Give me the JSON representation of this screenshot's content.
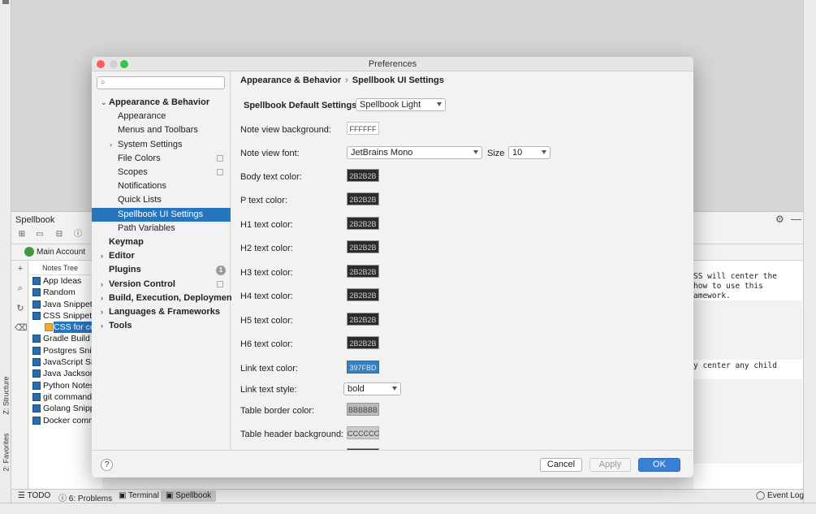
{
  "ide": {
    "tool_window_title": "Spellbook",
    "account_label": "Main Account",
    "notes_tree_header": "Notes Tree",
    "notes": [
      "App Ideas",
      "Random",
      "Java Snippet",
      "CSS Snippets",
      "CSS for ce",
      "Gradle Build",
      "Postgres Snip",
      "JavaScript Sn",
      "Java Jackson",
      "Python Notes",
      "git command",
      "Golang Snipp",
      "Docker comm"
    ],
    "selected_note_index": 4,
    "editor_lines": [
      "SS will center the",
      " how to use this",
      "amework.",
      "y center any child"
    ],
    "vertical_labels": {
      "structure": "Z: Structure",
      "favorites": "2: Favorites"
    },
    "status_bar": {
      "todo": "TODO",
      "problems": "6: Problems",
      "terminal": "Terminal",
      "spellbook": "Spellbook",
      "event_log": "Event Log"
    }
  },
  "dialog": {
    "title": "Preferences",
    "search": {
      "value": "",
      "placeholder": ""
    },
    "nav": [
      {
        "label": "Appearance & Behavior",
        "bold": true,
        "chevron": "v",
        "level": 0
      },
      {
        "label": "Appearance",
        "level": 1
      },
      {
        "label": "Menus and Toolbars",
        "level": 1
      },
      {
        "label": "System Settings",
        "level": 1,
        "chevron": ">"
      },
      {
        "label": "File Colors",
        "level": 1,
        "copy": true
      },
      {
        "label": "Scopes",
        "level": 1,
        "copy": true
      },
      {
        "label": "Notifications",
        "level": 1
      },
      {
        "label": "Quick Lists",
        "level": 1
      },
      {
        "label": "Spellbook UI Settings",
        "level": 1,
        "selected": true
      },
      {
        "label": "Path Variables",
        "level": 1
      },
      {
        "label": "Keymap",
        "bold": true,
        "level": 0
      },
      {
        "label": "Editor",
        "bold": true,
        "level": 0,
        "chevron": ">"
      },
      {
        "label": "Plugins",
        "bold": true,
        "level": 0,
        "badge": "1"
      },
      {
        "label": "Version Control",
        "bold": true,
        "level": 0,
        "chevron": ">",
        "copy": true
      },
      {
        "label": "Build, Execution, Deployment",
        "bold": true,
        "level": 0,
        "chevron": ">"
      },
      {
        "label": "Languages & Frameworks",
        "bold": true,
        "level": 0,
        "chevron": ">"
      },
      {
        "label": "Tools",
        "bold": true,
        "level": 0,
        "chevron": ">"
      }
    ],
    "breadcrumb": {
      "parent": "Appearance & Behavior",
      "separator": "›",
      "current": "Spellbook UI Settings"
    },
    "settings": {
      "default_settings_label": "Spellbook Default Settings:",
      "default_settings_value": "Spellbook Light",
      "note_view_background_label": "Note view background:",
      "note_view_background_value": "FFFFFF",
      "note_view_font_label": "Note view font:",
      "note_view_font_value": "JetBrains Mono",
      "size_label": "Size",
      "size_value": "10",
      "body_text_color_label": "Body text color:",
      "body_text_color_value": "2B2B2B",
      "p_text_color_label": "P text color:",
      "p_text_color_value": "2B2B2B",
      "h1_text_color_label": "H1 text color:",
      "h1_text_color_value": "2B2B2B",
      "h2_text_color_label": "H2 text color:",
      "h2_text_color_value": "2B2B2B",
      "h3_text_color_label": "H3 text color:",
      "h3_text_color_value": "2B2B2B",
      "h4_text_color_label": "H4 text color:",
      "h4_text_color_value": "2B2B2B",
      "h5_text_color_label": "H5 text color:",
      "h5_text_color_value": "2B2B2B",
      "h6_text_color_label": "H6 text color:",
      "h6_text_color_value": "2B2B2B",
      "link_text_color_label": "Link text color:",
      "link_text_color_value": "397FBD",
      "link_text_style_label": "Link text style:",
      "link_text_style_value": "bold",
      "table_border_color_label": "Table border color:",
      "table_border_color_value": "BBBBBB",
      "table_header_background_label": "Table header background:",
      "table_header_background_value": "CCCCCC"
    },
    "footer": {
      "help": "?",
      "cancel": "Cancel",
      "apply": "Apply",
      "ok": "OK"
    }
  },
  "colors": {
    "selection": "#2675bf",
    "ok_button": "#3b7fd4",
    "swatch_dark": "#2b2b2b",
    "swatch_link": "#397fbd",
    "swatch_border": "#bbbbbb",
    "swatch_header": "#cccccc",
    "swatch_bg": "#ffffff"
  }
}
